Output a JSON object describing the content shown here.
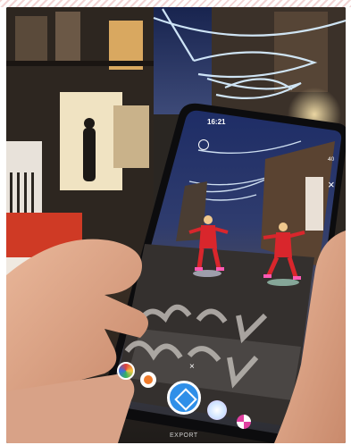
{
  "phone": {
    "status_time": "16:21",
    "battery": "40",
    "export_label": "EXPORT",
    "close_glyph": "×",
    "dismiss_glyph": "×"
  },
  "ground_graffiti_text": [
    "MOUT",
    "MOLO"
  ],
  "icons": {
    "settings": "gear-icon",
    "capture": "shutter-button",
    "close": "close-icon"
  },
  "colors": {
    "sky": "#1d2c5e",
    "street": "#2c2a28",
    "elf_red": "#d9262c",
    "lights": "#cfe9ff",
    "shutter_ring": "#2f8fe8"
  }
}
